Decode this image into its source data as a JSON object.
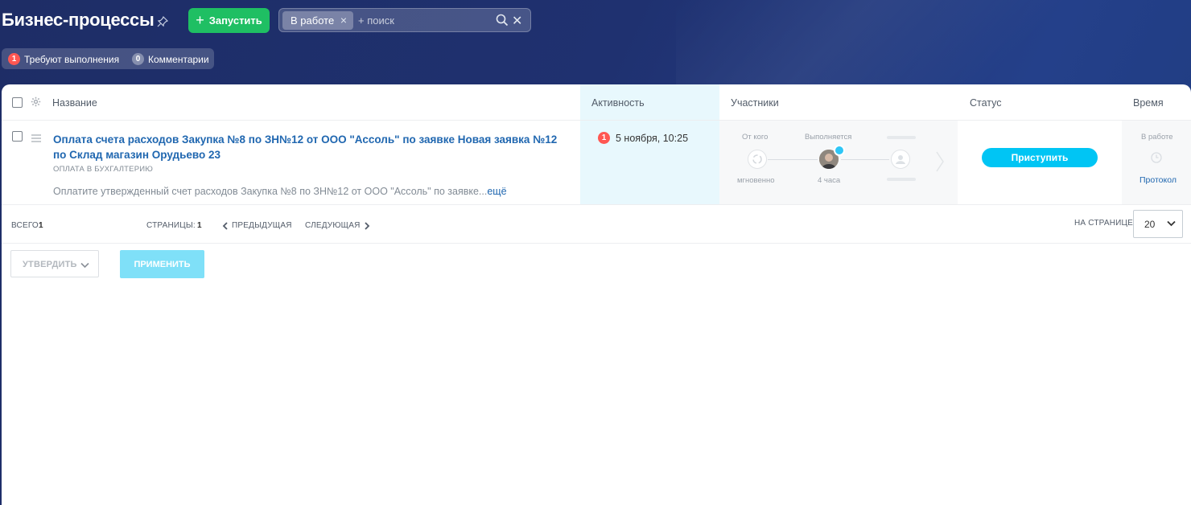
{
  "header": {
    "title": "Бизнес-процессы",
    "launch_label": "Запустить",
    "filter_chip": "В работе",
    "search_placeholder": "+ поиск"
  },
  "counters": [
    {
      "count": "1",
      "label": "Требуют выполнения"
    },
    {
      "count": "0",
      "label": "Комментарии"
    }
  ],
  "columns": {
    "name": "Название",
    "activity": "Активность",
    "participants": "Участники",
    "status": "Статус",
    "time": "Время"
  },
  "row": {
    "title": "Оплата счета расходов Закупка №8 по ЗН№12 от ООО \"Ассоль\" по заявке Новая заявка №12 по Склад магазин Орудьево 23",
    "category": "ОПЛАТА В БУХГАЛТЕРИЮ",
    "description": "Оплатите утвержденный счет расходов Закупка №8 по ЗН№12 от ООО \"Ассоль\" по заявке...",
    "more": "ещё",
    "activity_badge": "1",
    "activity_date": "5 ноября, 10:25",
    "from_label": "От кого",
    "from_time": "мгновенно",
    "doing_label": "Выполняется",
    "doing_time": "4 часа",
    "status_button": "Приступить",
    "time_state": "В работе",
    "protocol": "Протокол"
  },
  "footer": {
    "total_label": "ВСЕГО:",
    "total_value": "1",
    "pages_label": "СТРАНИЦЫ:",
    "pages_value": "1",
    "prev": "ПРЕДЫДУЩАЯ",
    "next": "СЛЕДУЮЩАЯ",
    "per_page_label": "НА СТРАНИЦЕ:",
    "per_page_value": "20"
  },
  "actions": {
    "approve": "УТВЕРДИТЬ",
    "apply": "ПРИМЕНИТЬ"
  },
  "colors": {
    "accent_green": "#1fbf63",
    "link_blue": "#2067b0",
    "cyan": "#00c5f4",
    "badge_red": "#ff5752"
  }
}
